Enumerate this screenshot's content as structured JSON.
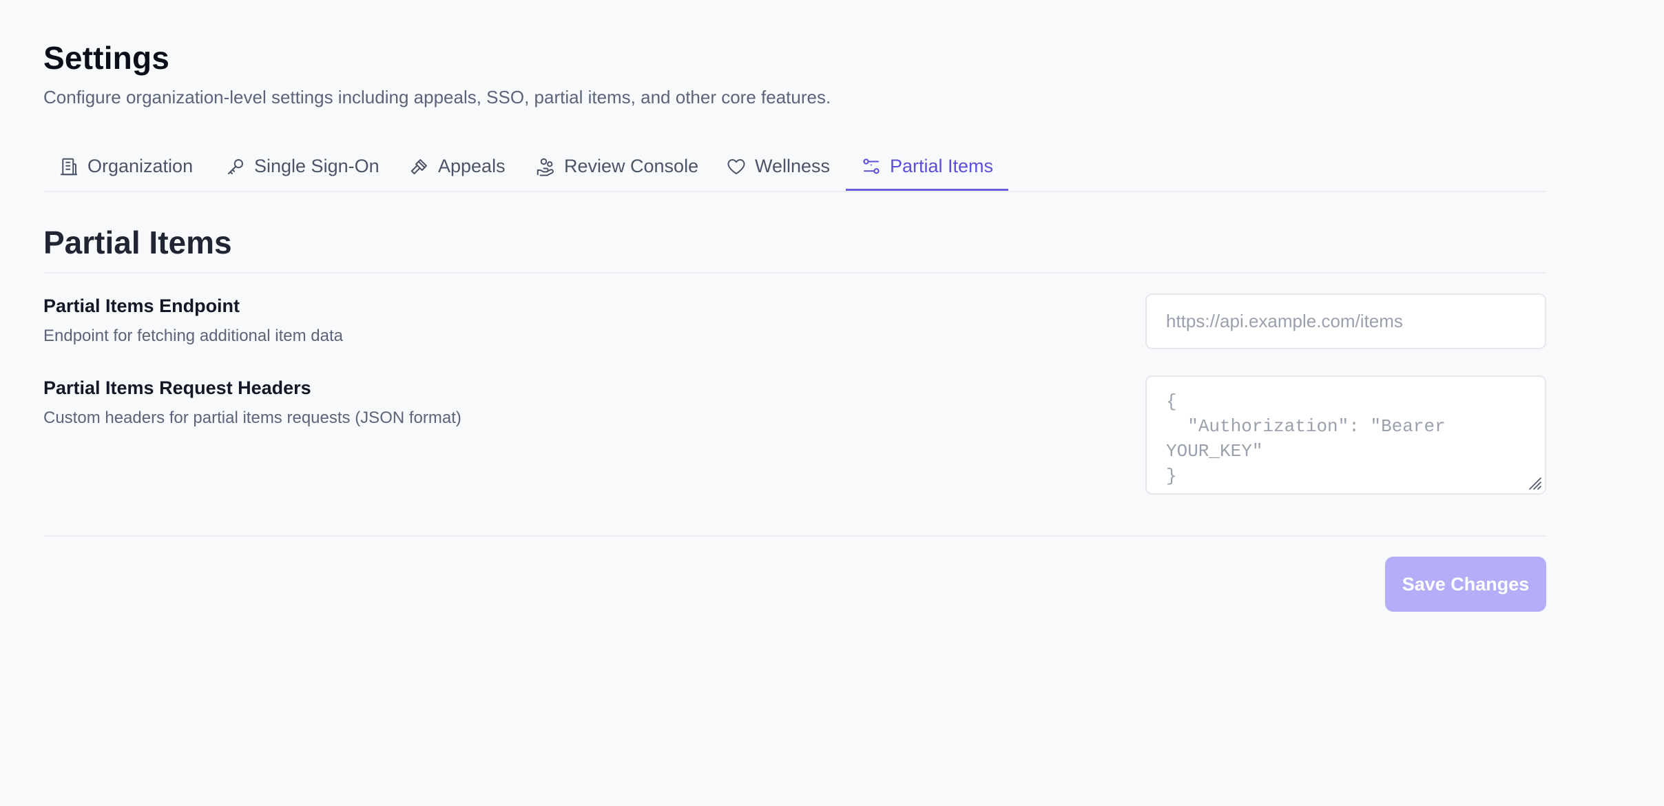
{
  "header": {
    "title": "Settings",
    "subtitle": "Configure organization-level settings including appeals, SSO, partial items, and other core features."
  },
  "tabs": [
    {
      "label": "Organization",
      "icon": "building-icon"
    },
    {
      "label": "Single Sign-On",
      "icon": "key-icon"
    },
    {
      "label": "Appeals",
      "icon": "gavel-icon"
    },
    {
      "label": "Review Console",
      "icon": "hand-coins-icon"
    },
    {
      "label": "Wellness",
      "icon": "heart-icon"
    },
    {
      "label": "Partial Items",
      "icon": "sliders-icon",
      "active": true
    }
  ],
  "section": {
    "title": "Partial Items"
  },
  "fields": {
    "endpoint": {
      "label": "Partial Items Endpoint",
      "help": "Endpoint for fetching additional item data",
      "value": "",
      "placeholder": "https://api.example.com/items"
    },
    "headers": {
      "label": "Partial Items Request Headers",
      "help": "Custom headers for partial items requests (JSON format)",
      "value": "",
      "placeholder": "{\n  \"Authorization\": \"Bearer YOUR_KEY\"\n}"
    }
  },
  "actions": {
    "save_label": "Save Changes"
  },
  "colors": {
    "accent": "#5b4fd6",
    "accent_underline": "#6b5fe0",
    "save_button_disabled": "#b3aef7",
    "background": "#f8f9fb"
  }
}
